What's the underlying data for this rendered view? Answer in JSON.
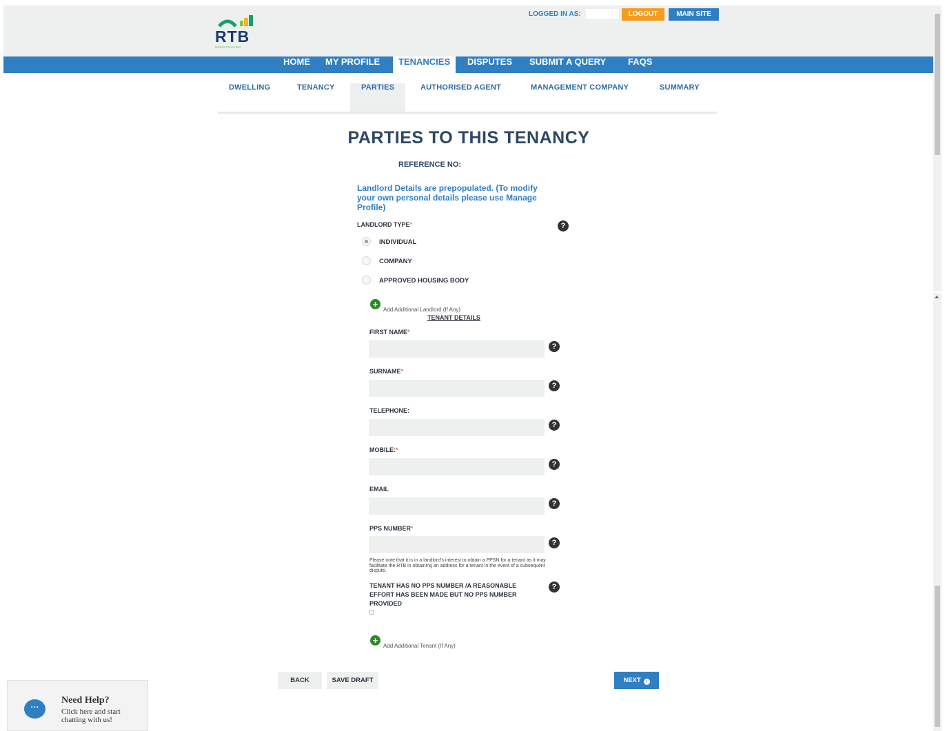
{
  "header": {
    "logo_text": "RTB",
    "logo_tagline": "Residential Tenancies Board",
    "logged_in_label": "LOGGED IN AS:",
    "logout_label": "LOGOUT",
    "main_site_label": "MAIN SITE"
  },
  "nav": {
    "items": [
      "HOME",
      "MY PROFILE",
      "TENANCIES",
      "DISPUTES",
      "SUBMIT A QUERY",
      "FAQS"
    ],
    "active": "TENANCIES"
  },
  "subnav": {
    "items": [
      "DWELLING",
      "TENANCY",
      "PARTIES",
      "AUTHORISED AGENT",
      "MANAGEMENT COMPANY",
      "SUMMARY"
    ],
    "active": "PARTIES"
  },
  "page": {
    "title": "PARTIES TO THIS TENANCY",
    "reference_label": "REFERENCE NO:",
    "landlord_note": "Landlord Details are prepopulated. (To modify your own personal details please use Manage Profile)"
  },
  "landlord": {
    "type_label": "LANDLORD TYPE",
    "required_mark": "*",
    "options": [
      "INDIVIDUAL",
      "COMPANY",
      "APPROVED HOUSING BODY"
    ],
    "selected": "INDIVIDUAL",
    "add_label": "Add Additional Landlord (If Any)"
  },
  "tenant": {
    "section_title": "TENANT DETAILS",
    "fields": {
      "first_name": {
        "label": "FIRST NAME",
        "req": "*",
        "value": ""
      },
      "surname": {
        "label": "SURNAME",
        "req": "*",
        "value": ""
      },
      "telephone": {
        "label": "TELEPHONE:",
        "req": "",
        "value": ""
      },
      "mobile": {
        "label": "MOBILE:",
        "req": "*",
        "value": ""
      },
      "email": {
        "label": "EMAIL",
        "req": "",
        "value": ""
      },
      "pps": {
        "label": "PPS NUMBER",
        "req": "*",
        "value": ""
      }
    },
    "pps_note": "Please note that it is in a landlord's interest to obtain a PPSN for a tenant as it may facilitate the RTB in obtaining an address for a tenant in the event of a subsequent dispute.",
    "no_pps_label": "TENANT HAS NO PPS NUMBER /A REASONABLE EFFORT HAS BEEN MADE BUT NO PPS NUMBER PROVIDED",
    "no_pps_checked": false,
    "add_label": "Add Additional Tenant (If Any)"
  },
  "actions": {
    "back": "BACK",
    "save_draft": "SAVE DRAFT",
    "next": "NEXT"
  },
  "chat": {
    "title": "Need Help?",
    "subtitle": "Click here and start chatting with us!",
    "icon_glyph": "···"
  },
  "icons": {
    "help": "?",
    "plus": "+",
    "next": "›"
  },
  "colors": {
    "brand_blue": "#2f7fc2",
    "logout_orange": "#f39c1f",
    "add_green": "#2a8a2a",
    "title_navy": "#2c4763"
  }
}
